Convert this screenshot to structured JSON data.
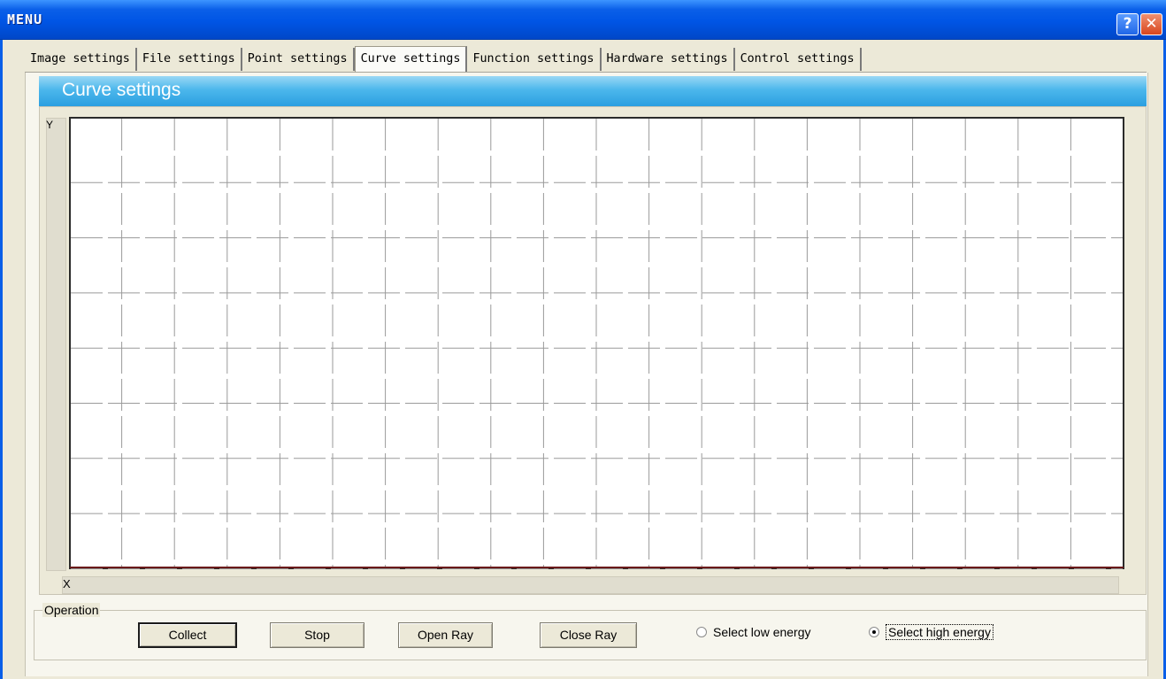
{
  "window": {
    "title": "MENU"
  },
  "tabs": [
    {
      "label": "Image settings"
    },
    {
      "label": "File settings"
    },
    {
      "label": "Point settings"
    },
    {
      "label": "Curve settings"
    },
    {
      "label": "Function settings"
    },
    {
      "label": "Hardware settings"
    },
    {
      "label": "Control settings"
    }
  ],
  "active_tab": 3,
  "panel": {
    "title": "Curve settings"
  },
  "chart": {
    "y_label": "Y",
    "x_label": "X",
    "grid": "dashed"
  },
  "operation": {
    "legend": "Operation",
    "collect_label": "Collect",
    "stop_label": "Stop",
    "open_ray_label": "Open Ray",
    "close_ray_label": "Close Ray",
    "low_energy_label": "Select low energy",
    "high_energy_label": "Select high energy",
    "selected_energy": "high"
  },
  "colors": {
    "title_bar": "#0a5fe8",
    "panel_header": "#3aaae6",
    "grid_line": "#9a9a9a"
  }
}
